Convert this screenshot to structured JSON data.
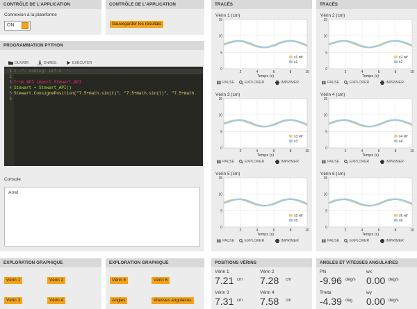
{
  "ctrl1": {
    "title": "CONTRÔLE DE L'APPLICATION",
    "connect_label": "Connexion à la plateforme",
    "toggle_label": "ON"
  },
  "ctrl2": {
    "title": "CONTRÔLE DE L'APPLICATION",
    "save_btn": "Sauvegarder les résultats"
  },
  "python": {
    "title": "PROGRAMMATION PYTHON",
    "toolbar": {
      "open": "OUVRIR",
      "save": "ENREG.",
      "run": "EXÉCUTER"
    },
    "code": [
      "# -*- coding: utf-8 -*-",
      "",
      "From API import Stewart_API",
      "Stewart = Stewart_API()",
      "Stewart.ConsignePosition(\"7.5+math.sin(t)\", \"7.5+math.sin(t)\", \"7.5+math.",
      ""
    ],
    "line_numbers": [
      "1",
      "2",
      "3",
      "4",
      "5",
      "6"
    ]
  },
  "console": {
    "label": "Console",
    "text": "Arret"
  },
  "traces_left": {
    "title": "TRACÉS"
  },
  "traces_right": {
    "title": "TRACÉS"
  },
  "plots": [
    {
      "title": "Vérin 1 (cm)",
      "legend": [
        "x1 réf",
        "x1"
      ]
    },
    {
      "title": "Vérin 2 (cm)",
      "legend": [
        "x2 réf",
        "x2"
      ]
    },
    {
      "title": "Vérin 3 (cm)",
      "legend": [
        "x3 réf",
        "x3"
      ]
    },
    {
      "title": "Vérin 4 (cm)",
      "legend": [
        "x4 réf",
        "x4"
      ]
    },
    {
      "title": "Vérin 5 (cm)",
      "legend": [
        "x5 réf",
        "x5"
      ]
    },
    {
      "title": "Vérin 6 (cm)",
      "legend": [
        "x6 réf",
        "x6"
      ]
    }
  ],
  "plot_common": {
    "xlabel": "Temps (s)",
    "xticks": [
      "2",
      "4",
      "6",
      "8",
      "10"
    ],
    "yticks": [
      "15",
      "10",
      "5",
      "0"
    ],
    "pause": "PAUSE",
    "explore": "EXPLORER",
    "print": "IMPRIMER",
    "ref_color": "#e8d27a",
    "meas_color": "#9ec9e8"
  },
  "explo1": {
    "title": "EXPLORATION GRAPHIQUE",
    "buttons": [
      "Vérin 1",
      "Vérin 2",
      "Vérin 3",
      "Vérin 4"
    ]
  },
  "explo2": {
    "title": "EXPLORATION GRAPHIQUE",
    "buttons": [
      "Vérin 5",
      "Vérin 6",
      "Angles",
      "Vitesses angulaires"
    ]
  },
  "positions": {
    "title": "POSITIONS VÉRINS",
    "items": [
      {
        "label": "Vérin 1",
        "value": "7.21",
        "unit": "cm"
      },
      {
        "label": "Vérin 2",
        "value": "7.28",
        "unit": "cm"
      },
      {
        "label": "Vérin 3",
        "value": "7.31",
        "unit": "cm"
      },
      {
        "label": "Vérin 4",
        "value": "7.58",
        "unit": "cm"
      }
    ]
  },
  "angles": {
    "title": "ANGLES ET VITESSES ANGULAIRES",
    "items": [
      {
        "label": "Phi",
        "value": "-9.96",
        "unit": "deg/s"
      },
      {
        "label": "wx",
        "value": "0.00",
        "unit": "deg/s"
      },
      {
        "label": "Theta",
        "value": "-4.39",
        "unit": "deg"
      },
      {
        "label": "wy",
        "value": "0.00",
        "unit": "deg/s"
      }
    ]
  },
  "chart_data": [
    {
      "type": "line",
      "title": "Vérin 1 (cm)",
      "xlabel": "Temps (s)",
      "xlim": [
        0,
        10
      ],
      "ylim": [
        0,
        15
      ],
      "series": [
        {
          "name": "x1 réf",
          "color": "#e8d27a",
          "x": [
            0,
            1,
            2,
            3,
            4,
            5,
            6,
            7,
            8,
            9,
            10
          ],
          "values": [
            7.5,
            8.3,
            8.4,
            7.6,
            6.7,
            6.5,
            7.2,
            8.2,
            8.5,
            7.9,
            6.9
          ]
        },
        {
          "name": "x1",
          "color": "#9ec9e8",
          "x": [
            0,
            1,
            2,
            3,
            4,
            5,
            6,
            7,
            8,
            9,
            10
          ],
          "values": [
            7.3,
            8.1,
            8.5,
            7.9,
            6.9,
            6.5,
            7.0,
            8.0,
            8.5,
            8.1,
            7.1
          ]
        }
      ]
    },
    {
      "type": "line",
      "title": "Vérin 2 (cm)",
      "xlabel": "Temps (s)",
      "xlim": [
        0,
        10
      ],
      "ylim": [
        0,
        15
      ],
      "series": [
        {
          "name": "x2 réf",
          "color": "#e8d27a",
          "x": [
            0,
            1,
            2,
            3,
            4,
            5,
            6,
            7,
            8,
            9,
            10
          ],
          "values": [
            7.5,
            8.3,
            8.4,
            7.6,
            6.7,
            6.5,
            7.2,
            8.2,
            8.5,
            7.9,
            6.9
          ]
        },
        {
          "name": "x2",
          "color": "#9ec9e8",
          "x": [
            0,
            1,
            2,
            3,
            4,
            5,
            6,
            7,
            8,
            9,
            10
          ],
          "values": [
            7.3,
            8.1,
            8.5,
            7.9,
            6.9,
            6.5,
            7.0,
            8.0,
            8.5,
            8.1,
            7.1
          ]
        }
      ]
    },
    {
      "type": "line",
      "title": "Vérin 3 (cm)",
      "xlabel": "Temps (s)",
      "xlim": [
        0,
        10
      ],
      "ylim": [
        0,
        15
      ],
      "series": [
        {
          "name": "x3 réf",
          "color": "#e8d27a",
          "x": [
            0,
            1,
            2,
            3,
            4,
            5,
            6,
            7,
            8,
            9,
            10
          ],
          "values": [
            7.5,
            8.3,
            8.4,
            7.6,
            6.7,
            6.5,
            7.2,
            8.2,
            8.5,
            7.9,
            6.9
          ]
        },
        {
          "name": "x3",
          "color": "#9ec9e8",
          "x": [
            0,
            1,
            2,
            3,
            4,
            5,
            6,
            7,
            8,
            9,
            10
          ],
          "values": [
            7.3,
            8.1,
            8.5,
            7.9,
            6.9,
            6.5,
            7.0,
            8.0,
            8.5,
            8.1,
            7.1
          ]
        }
      ]
    },
    {
      "type": "line",
      "title": "Vérin 4 (cm)",
      "xlabel": "Temps (s)",
      "xlim": [
        0,
        10
      ],
      "ylim": [
        0,
        15
      ],
      "series": [
        {
          "name": "x4 réf",
          "color": "#e8d27a",
          "x": [
            0,
            1,
            2,
            3,
            4,
            5,
            6,
            7,
            8,
            9,
            10
          ],
          "values": [
            7.5,
            8.3,
            8.4,
            7.6,
            6.7,
            6.5,
            7.2,
            8.2,
            8.5,
            7.9,
            6.9
          ]
        },
        {
          "name": "x4",
          "color": "#9ec9e8",
          "x": [
            0,
            1,
            2,
            3,
            4,
            5,
            6,
            7,
            8,
            9,
            10
          ],
          "values": [
            7.3,
            8.1,
            8.5,
            7.9,
            6.9,
            6.5,
            7.0,
            8.0,
            8.5,
            8.1,
            7.1
          ]
        }
      ]
    },
    {
      "type": "line",
      "title": "Vérin 5 (cm)",
      "xlabel": "Temps (s)",
      "xlim": [
        0,
        10
      ],
      "ylim": [
        0,
        15
      ],
      "series": [
        {
          "name": "x5 réf",
          "color": "#e8d27a",
          "x": [
            0,
            1,
            2,
            3,
            4,
            5,
            6,
            7,
            8,
            9,
            10
          ],
          "values": [
            7.5,
            8.3,
            8.4,
            7.6,
            6.7,
            6.5,
            7.2,
            8.2,
            8.5,
            7.9,
            6.9
          ]
        },
        {
          "name": "x5",
          "color": "#9ec9e8",
          "x": [
            0,
            1,
            2,
            3,
            4,
            5,
            6,
            7,
            8,
            9,
            10
          ],
          "values": [
            7.3,
            8.1,
            8.5,
            7.9,
            6.9,
            6.5,
            7.0,
            8.0,
            8.5,
            8.1,
            7.1
          ]
        }
      ]
    },
    {
      "type": "line",
      "title": "Vérin 6 (cm)",
      "xlabel": "Temps (s)",
      "xlim": [
        0,
        10
      ],
      "ylim": [
        0,
        15
      ],
      "series": [
        {
          "name": "x6 réf",
          "color": "#e8d27a",
          "x": [
            0,
            1,
            2,
            3,
            4,
            5,
            6,
            7,
            8,
            9,
            10
          ],
          "values": [
            7.5,
            8.3,
            8.4,
            7.6,
            6.7,
            6.5,
            7.2,
            8.2,
            8.5,
            7.9,
            6.9
          ]
        },
        {
          "name": "x6",
          "color": "#9ec9e8",
          "x": [
            0,
            1,
            2,
            3,
            4,
            5,
            6,
            7,
            8,
            9,
            10
          ],
          "values": [
            7.3,
            8.1,
            8.5,
            7.9,
            6.9,
            6.5,
            7.0,
            8.0,
            8.5,
            8.1,
            7.1
          ]
        }
      ]
    }
  ]
}
